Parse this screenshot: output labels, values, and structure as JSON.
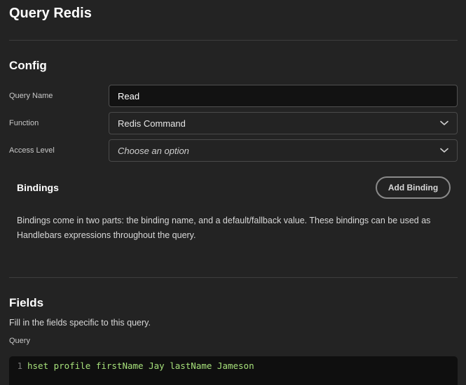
{
  "page": {
    "title": "Query Redis"
  },
  "config": {
    "title": "Config",
    "query_name": {
      "label": "Query Name",
      "value": "Read"
    },
    "function": {
      "label": "Function",
      "value": "Redis Command"
    },
    "access_level": {
      "label": "Access Level",
      "placeholder": "Choose an option"
    }
  },
  "bindings": {
    "title": "Bindings",
    "add_label": "Add Binding",
    "description": "Bindings come in two parts: the binding name, and a default/fallback value. These bindings can be used as Handlebars expressions throughout the query."
  },
  "fields": {
    "title": "Fields",
    "description": "Fill in the fields specific to this query.",
    "query_label": "Query",
    "editor": {
      "line_number": "1",
      "code": "hset profile firstName Jay lastName Jameson"
    }
  },
  "icons": {
    "select_arrow": "chevron-down-icon"
  }
}
